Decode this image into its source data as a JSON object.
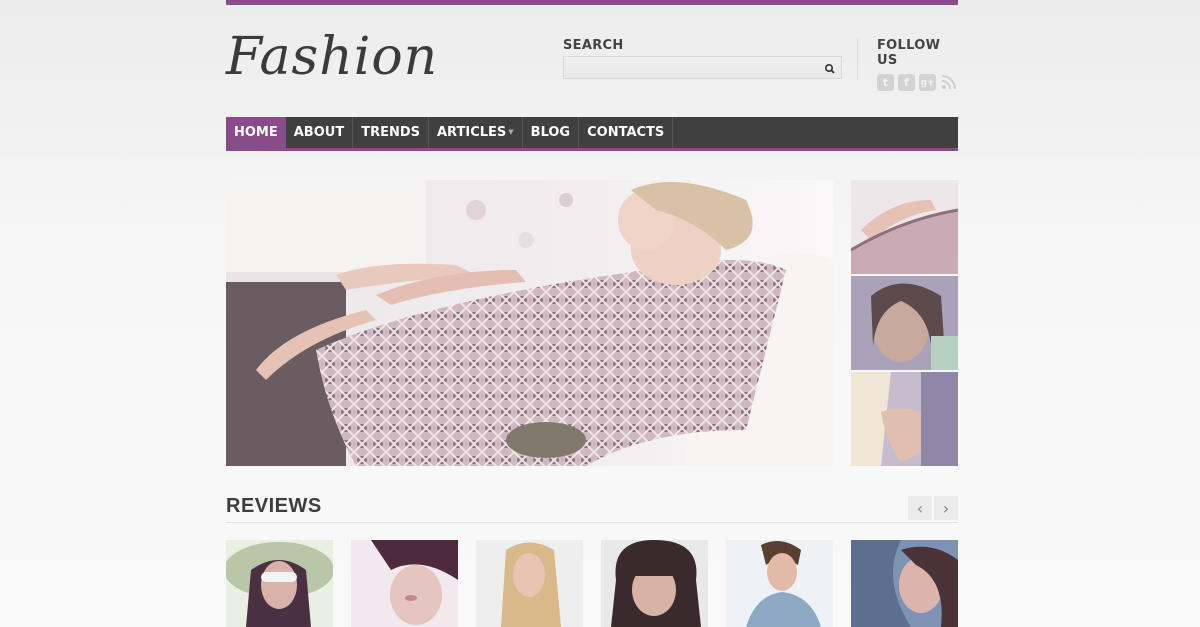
{
  "brand": {
    "logo_text": "Fashion",
    "accent_color": "#8a4b8b"
  },
  "search": {
    "title": "SEARCH",
    "placeholder": "",
    "button_icon": "search-icon"
  },
  "follow": {
    "title": "FOLLOW US",
    "icons": [
      {
        "name": "twitter-icon",
        "glyph": "t"
      },
      {
        "name": "facebook-icon",
        "glyph": "f"
      },
      {
        "name": "googleplus-icon",
        "glyph": "g+"
      },
      {
        "name": "rss-icon",
        "glyph": "❟"
      }
    ]
  },
  "nav": {
    "items": [
      {
        "label": "HOME",
        "active": true
      },
      {
        "label": "ABOUT",
        "active": false
      },
      {
        "label": "TRENDS",
        "active": false
      },
      {
        "label": "ARTICLES",
        "active": false,
        "has_dropdown": true
      },
      {
        "label": "BLOG",
        "active": false
      },
      {
        "label": "CONTACTS",
        "active": false
      }
    ]
  },
  "slider": {
    "main_image": "woman-in-wicker-chair-photo",
    "thumbnails": [
      "wicker-chair-thumb",
      "woman-portrait-thumb",
      "hand-detail-thumb"
    ]
  },
  "reviews": {
    "title": "REVIEWS",
    "prev_icon": "chevron-left-icon",
    "next_icon": "chevron-right-icon",
    "items": [
      "woman-sun-hat-photo",
      "woman-short-hair-photo",
      "blonde-woman-photo",
      "woman-bob-haircut-photo",
      "man-denim-jacket-photo",
      "woman-windswept-hair-photo"
    ]
  }
}
